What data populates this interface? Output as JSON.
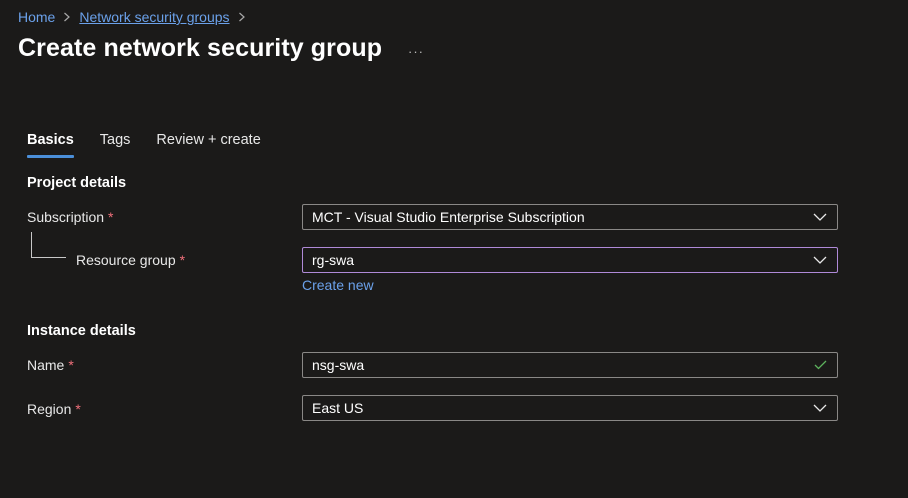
{
  "breadcrumb": {
    "items": [
      {
        "label": "Home"
      },
      {
        "label": "Network security groups"
      }
    ]
  },
  "page": {
    "title": "Create network security group",
    "more_label": "···"
  },
  "tabs": [
    {
      "label": "Basics",
      "active": true
    },
    {
      "label": "Tags",
      "active": false
    },
    {
      "label": "Review + create",
      "active": false
    }
  ],
  "project_details": {
    "heading": "Project details",
    "subscription": {
      "label": "Subscription",
      "required_marker": "*",
      "value": "MCT - Visual Studio Enterprise Subscription"
    },
    "resource_group": {
      "label": "Resource group",
      "required_marker": "*",
      "value": "rg-swa",
      "create_new": "Create new"
    }
  },
  "instance_details": {
    "heading": "Instance details",
    "name": {
      "label": "Name",
      "required_marker": "*",
      "value": "nsg-swa",
      "valid": true
    },
    "region": {
      "label": "Region",
      "required_marker": "*",
      "value": "East US"
    }
  },
  "colors": {
    "background": "#1b1a19",
    "link": "#6ba1ea",
    "tab_underline": "#4b8fd9",
    "required": "#f1707b",
    "focus_border": "#b08ad8",
    "valid_check": "#5db35d"
  },
  "icons": [
    "chevron-right-icon",
    "chevron-down-icon",
    "checkmark-icon",
    "more-icon"
  ]
}
